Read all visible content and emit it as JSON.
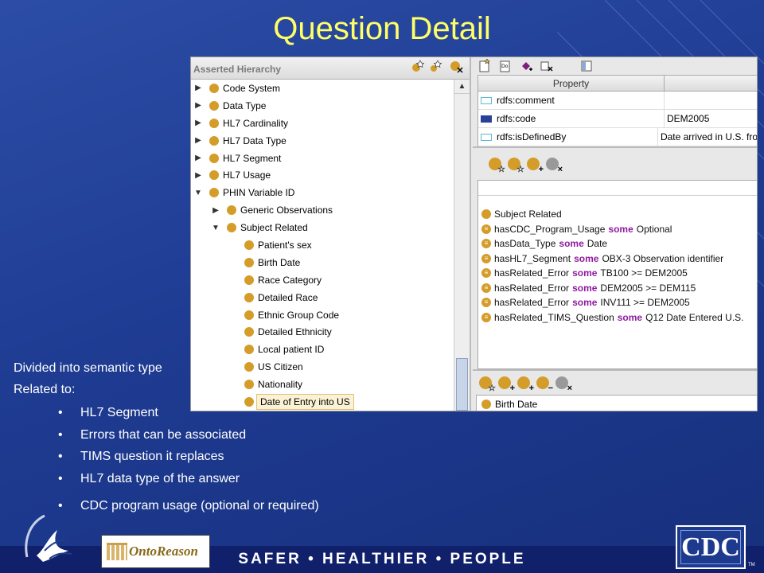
{
  "title": "Question Detail",
  "hierarchy": {
    "header": "Asserted Hierarchy",
    "items": [
      {
        "label": "Code System",
        "indent": 0,
        "toggle": "▶",
        "selected": false
      },
      {
        "label": "Data Type",
        "indent": 0,
        "toggle": "▶",
        "selected": false
      },
      {
        "label": "HL7 Cardinality",
        "indent": 0,
        "toggle": "▶",
        "selected": false
      },
      {
        "label": "HL7 Data Type",
        "indent": 0,
        "toggle": "▶",
        "selected": false
      },
      {
        "label": "HL7 Segment",
        "indent": 0,
        "toggle": "▶",
        "selected": false
      },
      {
        "label": "HL7 Usage",
        "indent": 0,
        "toggle": "▶",
        "selected": false
      },
      {
        "label": "PHIN Variable ID",
        "indent": 0,
        "toggle": "▼",
        "selected": false
      },
      {
        "label": "Generic Observations",
        "indent": 1,
        "toggle": "▶",
        "selected": false
      },
      {
        "label": "Subject Related",
        "indent": 1,
        "toggle": "▼",
        "selected": false
      },
      {
        "label": "Patient's sex",
        "indent": 2,
        "toggle": "",
        "selected": false
      },
      {
        "label": "Birth Date",
        "indent": 2,
        "toggle": "",
        "selected": false
      },
      {
        "label": "Race Category",
        "indent": 2,
        "toggle": "",
        "selected": false
      },
      {
        "label": "Detailed Race",
        "indent": 2,
        "toggle": "",
        "selected": false
      },
      {
        "label": "Ethnic Group Code",
        "indent": 2,
        "toggle": "",
        "selected": false
      },
      {
        "label": "Detailed Ethnicity",
        "indent": 2,
        "toggle": "",
        "selected": false
      },
      {
        "label": "Local patient ID",
        "indent": 2,
        "toggle": "",
        "selected": false
      },
      {
        "label": "US Citizen",
        "indent": 2,
        "toggle": "",
        "selected": false
      },
      {
        "label": "Nationality",
        "indent": 2,
        "toggle": "",
        "selected": false
      },
      {
        "label": "Date of Entry into US",
        "indent": 2,
        "toggle": "",
        "selected": true
      }
    ]
  },
  "properties": {
    "header_property": "Property",
    "rows": [
      {
        "name": "rdfs:comment",
        "value": "",
        "color": "#5fb7d5"
      },
      {
        "name": "rdfs:code",
        "value": "DEM2005",
        "color": "#2a3f9a"
      },
      {
        "name": "rdfs:isDefinedBy",
        "value": "Date arrived in U.S. fro",
        "color": "#5fb7d5"
      }
    ]
  },
  "asserted_conditions": [
    {
      "parts": [
        "Subject Related"
      ],
      "kw": "",
      "symbol": ""
    },
    {
      "parts": [
        "hasCDC_Program_Usage",
        "Optional"
      ],
      "kw": "some",
      "symbol": "≡"
    },
    {
      "parts": [
        "hasData_Type",
        "Date"
      ],
      "kw": "some",
      "symbol": "≡"
    },
    {
      "parts": [
        "hasHL7_Segment",
        "OBX-3 Observation identifier"
      ],
      "kw": "some",
      "symbol": "≡"
    },
    {
      "parts": [
        "hasRelated_Error",
        "TB100 >= DEM2005"
      ],
      "kw": "some",
      "symbol": "≡"
    },
    {
      "parts": [
        "hasRelated_Error",
        "DEM2005 >= DEM115"
      ],
      "kw": "some",
      "symbol": "≡"
    },
    {
      "parts": [
        "hasRelated_Error",
        "INV111 >= DEM2005"
      ],
      "kw": "some",
      "symbol": "≡"
    },
    {
      "parts": [
        "hasRelated_TIMS_Question",
        "Q12 Date Entered U.S."
      ],
      "kw": "some",
      "symbol": "≡"
    }
  ],
  "disjoint": {
    "item": "Birth Date"
  },
  "notes": {
    "line1": "Divided into semantic type",
    "line2": "Related to:"
  },
  "bullets": [
    "HL7 Segment",
    "Errors that can be associated",
    "TIMS question it replaces",
    "HL7 data type of the answer",
    "CDC program usage (optional or required)"
  ],
  "footer": {
    "tagline": "SAFER • HEALTHIER • PEOPLE",
    "onto_logo": "OntoReason",
    "cdc_logo": "CDC",
    "tm": "TM"
  },
  "colors": {
    "title": "#ffff66",
    "class_dot": "#d49d2a",
    "keyword": "#8e1a9e"
  }
}
